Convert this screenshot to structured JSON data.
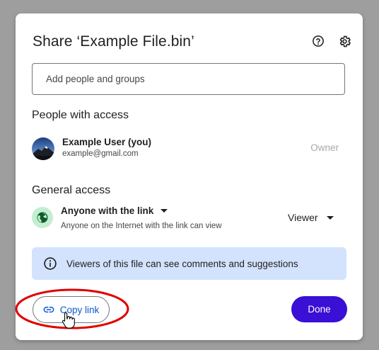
{
  "dialog": {
    "title": "Share ‘Example File.bin’",
    "help_icon": "help-circle-icon",
    "settings_icon": "gear-icon"
  },
  "share_input": {
    "placeholder": "Add people and groups",
    "value": ""
  },
  "people_section": {
    "title": "People with access",
    "users": [
      {
        "name": "Example User (you)",
        "email": "example@gmail.com",
        "role": "Owner"
      }
    ]
  },
  "general_access": {
    "title": "General access",
    "selected": "Anyone with the link",
    "description": "Anyone on the Internet with the link can view",
    "role": "Viewer"
  },
  "info_banner": {
    "text": "Viewers of this file can see comments and suggestions"
  },
  "footer": {
    "copy_link_label": "Copy link",
    "done_label": "Done"
  },
  "colors": {
    "accent": "#0b57d0",
    "done_button": "#3a0fd6",
    "banner": "#d3e3fd",
    "globe_bg": "#c4eed0",
    "annotation": "#e00000"
  }
}
